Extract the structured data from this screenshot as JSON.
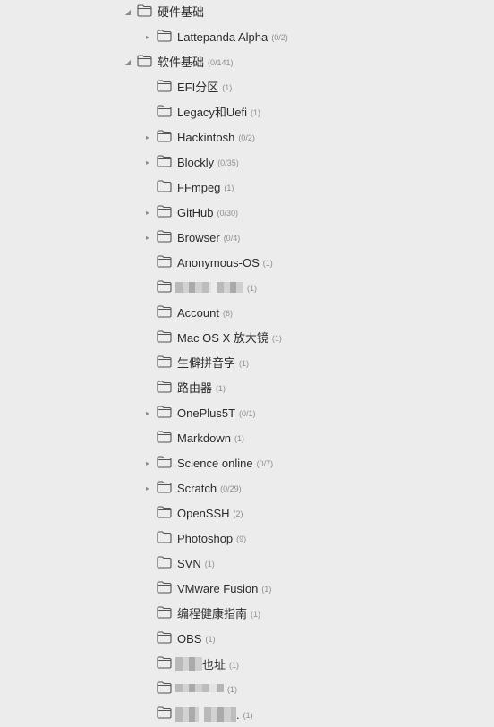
{
  "tree": {
    "hardware": {
      "label": "硬件基础",
      "children": [
        {
          "label": "Lattepanda Alpha",
          "count": "(0/2)"
        }
      ]
    },
    "software": {
      "label": "软件基础",
      "count": "(0/141)",
      "children": [
        {
          "label": "EFI分区",
          "count": "(1)"
        },
        {
          "label": "Legacy和Uefi",
          "count": "(1)"
        },
        {
          "label": "Hackintosh",
          "count": "(0/2)"
        },
        {
          "label": "Blockly",
          "count": "(0/35)"
        },
        {
          "label": "FFmpeg",
          "count": "(1)"
        },
        {
          "label": "GitHub",
          "count": "(0/30)"
        },
        {
          "label": "Browser",
          "count": "(0/4)"
        },
        {
          "label": "Anonymous-OS",
          "count": "(1)"
        },
        {
          "label": "",
          "count": "(1)"
        },
        {
          "label": "Account",
          "count": "(6)"
        },
        {
          "label": "Mac OS X 放大镜",
          "count": "(1)"
        },
        {
          "label": "生僻拼音字",
          "count": "(1)"
        },
        {
          "label": "路由器",
          "count": "(1)"
        },
        {
          "label": "OnePlus5T",
          "count": "(0/1)"
        },
        {
          "label": "Markdown",
          "count": "(1)"
        },
        {
          "label": "Science online",
          "count": "(0/7)"
        },
        {
          "label": "Scratch",
          "count": "(0/29)"
        },
        {
          "label": "OpenSSH",
          "count": "(2)"
        },
        {
          "label": "Photoshop",
          "count": "(9)"
        },
        {
          "label": "SVN",
          "count": "(1)"
        },
        {
          "label": "VMware Fusion",
          "count": "(1)"
        },
        {
          "label": "编程健康指南",
          "count": "(1)"
        },
        {
          "label": "OBS",
          "count": "(1)"
        },
        {
          "label": "也址",
          "count": "(1)"
        },
        {
          "label": "",
          "count": "(1)"
        },
        {
          "label": ".",
          "count": "(1)"
        }
      ]
    }
  },
  "colors": {
    "background": "#ececec",
    "text": "#2b2b2b",
    "count": "#8e8e8e",
    "icon_stroke": "#555555"
  }
}
